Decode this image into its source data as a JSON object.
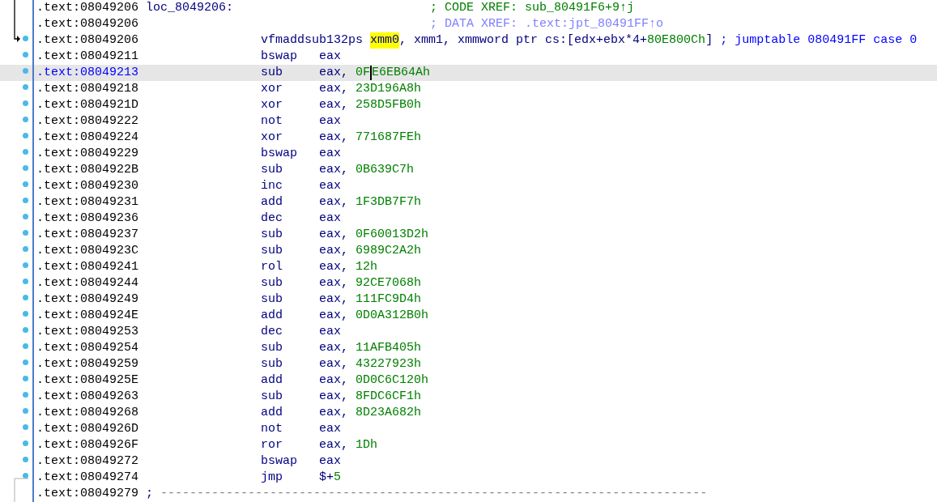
{
  "listing": [
    {
      "address": ".text:08049206",
      "label": "loc_8049206:",
      "comment": {
        "text": "; CODE XREF: sub_80491F6+9↑j",
        "kind": "code_xref"
      },
      "dot": false,
      "selected": false
    },
    {
      "address": ".text:08049206",
      "comment": {
        "text": "; DATA XREF: .text:jpt_80491FF↑o",
        "kind": "data_xref"
      },
      "dot": false,
      "selected": false
    },
    {
      "address": ".text:08049206",
      "mnemonic": "vfmaddsub132ps",
      "operands": [
        {
          "text": "xmm0",
          "kind": "highlight"
        },
        {
          "text": ", xmm1, xmmword ptr cs:[edx+ebx*4+",
          "kind": "reg"
        },
        {
          "text": "80E800Ch",
          "kind": "num"
        },
        {
          "text": "]",
          "kind": "reg"
        }
      ],
      "comment": {
        "text": "; jumptable 080491FF case 0",
        "kind": "note"
      },
      "dot": true,
      "selected": false
    },
    {
      "address": ".text:08049211",
      "mnemonic": "bswap",
      "operands": [
        {
          "text": "eax",
          "kind": "reg"
        }
      ],
      "dot": true,
      "selected": false
    },
    {
      "address": ".text:08049213",
      "mnemonic": "sub",
      "operands": [
        {
          "text": "eax, ",
          "kind": "reg"
        },
        {
          "text": "0F",
          "kind": "num",
          "caret": true
        },
        {
          "text": "E6EB64Ah",
          "kind": "num"
        }
      ],
      "dot": true,
      "selected": true
    },
    {
      "address": ".text:08049218",
      "mnemonic": "xor",
      "operands": [
        {
          "text": "eax, ",
          "kind": "reg"
        },
        {
          "text": "23D196A8h",
          "kind": "num"
        }
      ],
      "dot": true,
      "selected": false
    },
    {
      "address": ".text:0804921D",
      "mnemonic": "xor",
      "operands": [
        {
          "text": "eax, ",
          "kind": "reg"
        },
        {
          "text": "258D5FB0h",
          "kind": "num"
        }
      ],
      "dot": true,
      "selected": false
    },
    {
      "address": ".text:08049222",
      "mnemonic": "not",
      "operands": [
        {
          "text": "eax",
          "kind": "reg"
        }
      ],
      "dot": true,
      "selected": false
    },
    {
      "address": ".text:08049224",
      "mnemonic": "xor",
      "operands": [
        {
          "text": "eax, ",
          "kind": "reg"
        },
        {
          "text": "771687FEh",
          "kind": "num"
        }
      ],
      "dot": true,
      "selected": false
    },
    {
      "address": ".text:08049229",
      "mnemonic": "bswap",
      "operands": [
        {
          "text": "eax",
          "kind": "reg"
        }
      ],
      "dot": true,
      "selected": false
    },
    {
      "address": ".text:0804922B",
      "mnemonic": "sub",
      "operands": [
        {
          "text": "eax, ",
          "kind": "reg"
        },
        {
          "text": "0B639C7h",
          "kind": "num"
        }
      ],
      "dot": true,
      "selected": false
    },
    {
      "address": ".text:08049230",
      "mnemonic": "inc",
      "operands": [
        {
          "text": "eax",
          "kind": "reg"
        }
      ],
      "dot": true,
      "selected": false
    },
    {
      "address": ".text:08049231",
      "mnemonic": "add",
      "operands": [
        {
          "text": "eax, ",
          "kind": "reg"
        },
        {
          "text": "1F3DB7F7h",
          "kind": "num"
        }
      ],
      "dot": true,
      "selected": false
    },
    {
      "address": ".text:08049236",
      "mnemonic": "dec",
      "operands": [
        {
          "text": "eax",
          "kind": "reg"
        }
      ],
      "dot": true,
      "selected": false
    },
    {
      "address": ".text:08049237",
      "mnemonic": "sub",
      "operands": [
        {
          "text": "eax, ",
          "kind": "reg"
        },
        {
          "text": "0F60013D2h",
          "kind": "num"
        }
      ],
      "dot": true,
      "selected": false
    },
    {
      "address": ".text:0804923C",
      "mnemonic": "sub",
      "operands": [
        {
          "text": "eax, ",
          "kind": "reg"
        },
        {
          "text": "6989C2A2h",
          "kind": "num"
        }
      ],
      "dot": true,
      "selected": false
    },
    {
      "address": ".text:08049241",
      "mnemonic": "rol",
      "operands": [
        {
          "text": "eax, ",
          "kind": "reg"
        },
        {
          "text": "12h",
          "kind": "num"
        }
      ],
      "dot": true,
      "selected": false
    },
    {
      "address": ".text:08049244",
      "mnemonic": "sub",
      "operands": [
        {
          "text": "eax, ",
          "kind": "reg"
        },
        {
          "text": "92CE7068h",
          "kind": "num"
        }
      ],
      "dot": true,
      "selected": false
    },
    {
      "address": ".text:08049249",
      "mnemonic": "sub",
      "operands": [
        {
          "text": "eax, ",
          "kind": "reg"
        },
        {
          "text": "111FC9D4h",
          "kind": "num"
        }
      ],
      "dot": true,
      "selected": false
    },
    {
      "address": ".text:0804924E",
      "mnemonic": "add",
      "operands": [
        {
          "text": "eax, ",
          "kind": "reg"
        },
        {
          "text": "0D0A312B0h",
          "kind": "num"
        }
      ],
      "dot": true,
      "selected": false
    },
    {
      "address": ".text:08049253",
      "mnemonic": "dec",
      "operands": [
        {
          "text": "eax",
          "kind": "reg"
        }
      ],
      "dot": true,
      "selected": false
    },
    {
      "address": ".text:08049254",
      "mnemonic": "sub",
      "operands": [
        {
          "text": "eax, ",
          "kind": "reg"
        },
        {
          "text": "11AFB405h",
          "kind": "num"
        }
      ],
      "dot": true,
      "selected": false
    },
    {
      "address": ".text:08049259",
      "mnemonic": "sub",
      "operands": [
        {
          "text": "eax, ",
          "kind": "reg"
        },
        {
          "text": "43227923h",
          "kind": "num"
        }
      ],
      "dot": true,
      "selected": false
    },
    {
      "address": ".text:0804925E",
      "mnemonic": "add",
      "operands": [
        {
          "text": "eax, ",
          "kind": "reg"
        },
        {
          "text": "0D0C6C120h",
          "kind": "num"
        }
      ],
      "dot": true,
      "selected": false
    },
    {
      "address": ".text:08049263",
      "mnemonic": "sub",
      "operands": [
        {
          "text": "eax, ",
          "kind": "reg"
        },
        {
          "text": "8FDC6CF1h",
          "kind": "num"
        }
      ],
      "dot": true,
      "selected": false
    },
    {
      "address": ".text:08049268",
      "mnemonic": "add",
      "operands": [
        {
          "text": "eax, ",
          "kind": "reg"
        },
        {
          "text": "8D23A682h",
          "kind": "num"
        }
      ],
      "dot": true,
      "selected": false
    },
    {
      "address": ".text:0804926D",
      "mnemonic": "not",
      "operands": [
        {
          "text": "eax",
          "kind": "reg"
        }
      ],
      "dot": true,
      "selected": false
    },
    {
      "address": ".text:0804926F",
      "mnemonic": "ror",
      "operands": [
        {
          "text": "eax, ",
          "kind": "reg"
        },
        {
          "text": "1Dh",
          "kind": "num"
        }
      ],
      "dot": true,
      "selected": false
    },
    {
      "address": ".text:08049272",
      "mnemonic": "bswap",
      "operands": [
        {
          "text": "eax",
          "kind": "reg"
        }
      ],
      "dot": true,
      "selected": false
    },
    {
      "address": ".text:08049274",
      "mnemonic": "jmp",
      "operands": [
        {
          "text": "$+",
          "kind": "reg"
        },
        {
          "text": "5",
          "kind": "num"
        }
      ],
      "dot": true,
      "selected": false
    },
    {
      "address": ".text:08049279",
      "separator": "; ---------------------------------------------------------------------------",
      "dot": false,
      "selected": false
    }
  ]
}
